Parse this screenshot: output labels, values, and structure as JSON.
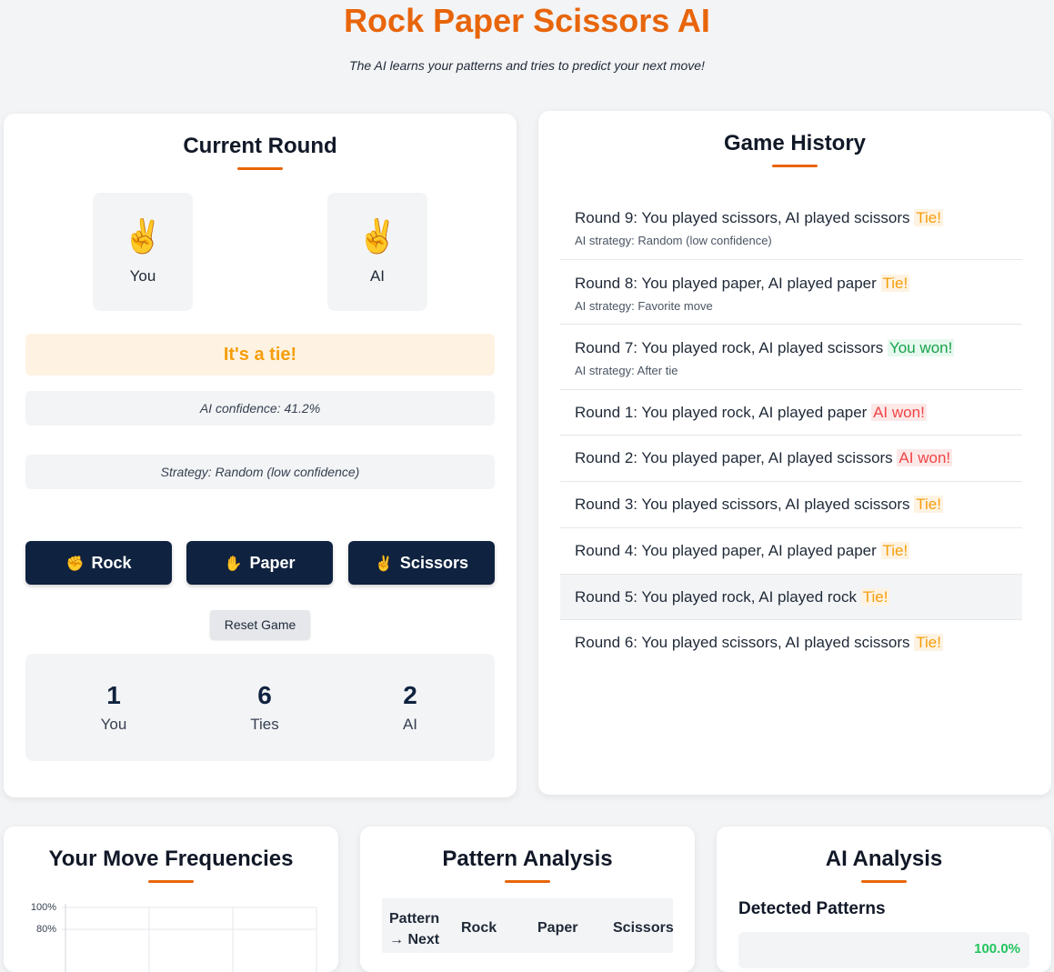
{
  "header": {
    "title": "Rock Paper Scissors AI",
    "subtitle": "The AI learns your patterns and tries to predict your next move!"
  },
  "current_round": {
    "title": "Current Round",
    "player": {
      "emoji": "✌️",
      "label": "You"
    },
    "ai": {
      "emoji": "✌️",
      "label": "AI"
    },
    "result": "It's a tie!",
    "confidence": "AI confidence: 41.2%",
    "strategy": "Strategy: Random (low confidence)",
    "buttons": {
      "rock": {
        "icon": "✊",
        "label": "Rock"
      },
      "paper": {
        "icon": "✋",
        "label": "Paper"
      },
      "scissors": {
        "icon": "✌️",
        "label": "Scissors"
      }
    },
    "reset_label": "Reset Game",
    "score": [
      {
        "value": "1",
        "label": "You"
      },
      {
        "value": "6",
        "label": "Ties"
      },
      {
        "value": "2",
        "label": "AI"
      }
    ]
  },
  "history": {
    "title": "Game History",
    "items": [
      {
        "text": "Round 9: You played scissors, AI played scissors",
        "result": "Tie!",
        "strategy": "AI strategy: Random (low confidence)"
      },
      {
        "text": "Round 8: You played paper, AI played paper",
        "result": "Tie!",
        "strategy": "AI strategy: Favorite move"
      },
      {
        "text": "Round 7: You played rock, AI played scissors",
        "result": "You won!",
        "strategy": "AI strategy: After tie"
      },
      {
        "text": "Round 1: You played rock, AI played paper",
        "result": "AI won!"
      },
      {
        "text": "Round 2: You played paper, AI played scissors",
        "result": "AI won!"
      },
      {
        "text": "Round 3: You played scissors, AI played scissors",
        "result": "Tie!"
      },
      {
        "text": "Round 4: You played paper, AI played paper",
        "result": "Tie!"
      },
      {
        "text": "Round 5: You played rock, AI played rock",
        "result": "Tie!"
      },
      {
        "text": "Round 6: You played scissors, AI played scissors",
        "result": "Tie!"
      }
    ]
  },
  "frequencies": {
    "title": "Your Move Frequencies",
    "yticks": [
      "100%",
      "80%"
    ]
  },
  "pattern": {
    "title": "Pattern Analysis",
    "headers": {
      "pattern": "Pattern",
      "next": "→ Next",
      "rock": "Rock",
      "paper": "Paper",
      "scissors": "Scissors"
    }
  },
  "ai_analysis": {
    "title": "AI Analysis",
    "detected_title": "Detected Patterns",
    "first_value": "100.0%"
  },
  "colors": {
    "accent": "#e8650a",
    "navy": "#0f223f",
    "tie": "#f59e0b",
    "win": "#16a34a",
    "loss": "#ef4444"
  }
}
